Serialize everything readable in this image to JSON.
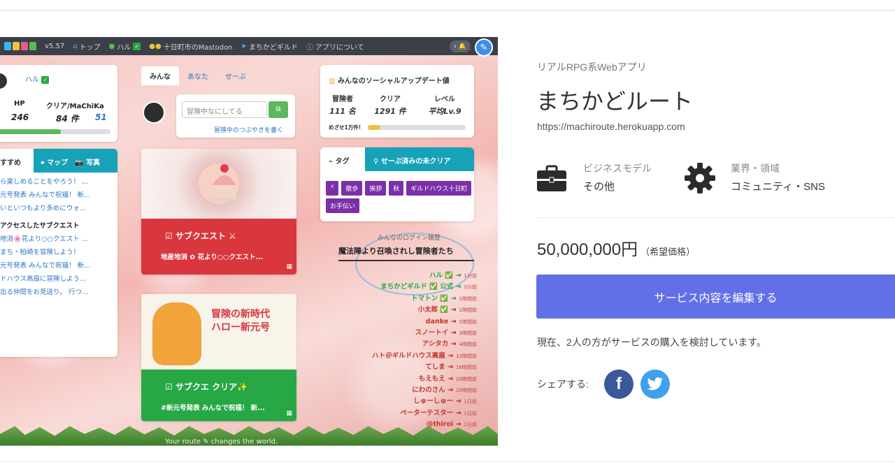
{
  "app": {
    "version": "v5.57",
    "nav": [
      {
        "icon": "home-icon",
        "label": "トップ"
      },
      {
        "icon": "user-icon",
        "label": "ハル"
      },
      {
        "icon": "users-icon",
        "label": "十日町市のMastodon"
      },
      {
        "icon": "send-icon",
        "label": "まちかどギルド"
      },
      {
        "icon": "help-icon",
        "label": "アプリについて"
      }
    ],
    "bell_label": "‹ 🔔",
    "profile": {
      "name": "ハル",
      "hp_label": "HP",
      "hp_value": "246",
      "clear_label": "クリア/MaChiKa",
      "clear_value": "84 件",
      "machika_value": "51",
      "hp_progress": 0.58
    },
    "recommend": {
      "tab_main": "すすめ",
      "tab_map": "マップ",
      "tab_photo": "写真",
      "items": [
        "ら楽しめることをやろう！ ...",
        "元号発表 みんなで祝福！ 新...",
        "いといつもより多めにウォ...",
        "アクセスしたサブクエスト",
        "地消🌸花より○○クエスト ...",
        "まち・柏崎を冒険しよう！",
        "元号発表 みんなで祝福！ 新...",
        "ドハウス高扇に冒険しよう...",
        "出る仲間をお見送り。 行つ..."
      ]
    },
    "feed_tabs": [
      "みんな",
      "あなた",
      "せーぶ"
    ],
    "composer": {
      "placeholder": "冒険中なにしてる",
      "link": "冒険中のつぶやきを書く"
    },
    "quest1": {
      "title": "サブクエスト ⚔",
      "subtitle": "地産地消 ✿ 花より○○クエスト..."
    },
    "quest2": {
      "banner": "冒険の新時代\nハロー新元号",
      "title": "サブクエ クリア✨",
      "subtitle": "#新元号発表 みんなで祝福！ 新..."
    },
    "social": {
      "title": "みんなのソーシャルアップデート値",
      "stats": [
        {
          "label": "冒険者",
          "value": "111 名"
        },
        {
          "label": "クリア",
          "value": "1291 件"
        },
        {
          "label": "レベル",
          "value": "平均Lv.9"
        }
      ],
      "goal_label": "めざせ1万件!",
      "goal_progress": 0.13
    },
    "tags": {
      "tab_main": "タグ",
      "tab_search": "せーぶ済みの未クリア",
      "items": [
        "⚡",
        "散歩",
        "挨拶",
        "秋",
        "ギルドハウス十日町",
        "お手伝い"
      ]
    },
    "summon": {
      "caption": "みんなのログイン履歴",
      "title": "魔法陣より召喚されし冒険者たち",
      "log": [
        {
          "name": "ハル ✅",
          "time": "1分前",
          "green": true
        },
        {
          "name": "まちかどギルド ✅ 公式",
          "time": "2分前",
          "green": true
        },
        {
          "name": "トマトン ✅",
          "time": "1時間前",
          "green": true
        },
        {
          "name": "小太郎 ✅",
          "time": "1時間前",
          "green": false
        },
        {
          "name": "danke",
          "time": "1時間前",
          "green": false
        },
        {
          "name": "スノートイ",
          "time": "3時間前",
          "green": false
        },
        {
          "name": "アシタカ",
          "time": "4時間前",
          "green": false
        },
        {
          "name": "ハト＠ギルドハウス高扇",
          "time": "13時間前",
          "green": false
        },
        {
          "name": "てしま",
          "time": "16時間前",
          "green": false
        },
        {
          "name": "もえもえ",
          "time": "20時間前",
          "green": false
        },
        {
          "name": "にわのさん",
          "time": "20時間前",
          "green": false
        },
        {
          "name": "しゅーしゅー",
          "time": "1日前",
          "green": false
        },
        {
          "name": "ペーターテスター",
          "time": "1日前",
          "green": false
        },
        {
          "name": "@thiroi",
          "time": "1日前",
          "green": false
        }
      ]
    },
    "footer": "Your route ✎ changes the world."
  },
  "product": {
    "category": "リアルRPG系Webアプリ",
    "title": "まちかどルート",
    "url": "https://machiroute.herokuapp.com",
    "business_model_label": "ビジネスモデル",
    "business_model_value": "その他",
    "industry_label": "業界・領域",
    "industry_value": "コミュニティ・SNS",
    "price": "50,000,000円",
    "price_note": "（希望価格）",
    "edit_button": "サービス内容を編集する",
    "interest_text": "現在、2人の方がサービスの購入を検討しています。",
    "share_label": "シェアする:",
    "facebook_icon": "facebook-icon",
    "twitter_icon": "twitter-icon"
  },
  "colors": {
    "accent": "#6270e8",
    "facebook": "#3b5998",
    "twitter": "#3ea1ec",
    "quest_red": "#d9363e",
    "quest_green": "#28a745",
    "teal": "#17a2b8",
    "tag_purple": "#7b2fa8"
  }
}
